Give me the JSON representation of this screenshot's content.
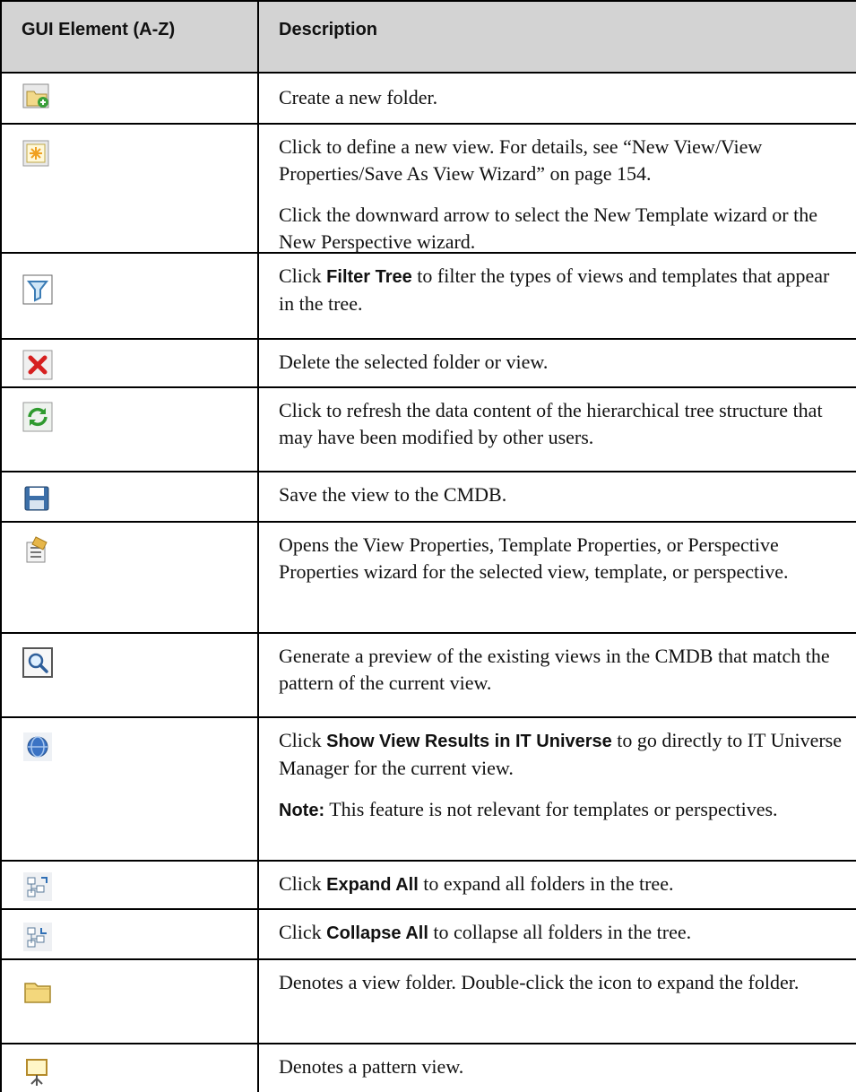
{
  "header": {
    "col1": "GUI Element (A-Z)",
    "col2": "Description"
  },
  "rows": [
    {
      "icon": "new-folder-icon",
      "paras": [
        {
          "text": "Create a new folder."
        }
      ]
    },
    {
      "icon": "new-view-icon",
      "paras": [
        {
          "text": "Click to define a new view. For details, see “New View/View Properties/Save As View Wizard” on page 154."
        },
        {
          "text": "Click the downward arrow to select the New Template wizard or the New Perspective wizard."
        }
      ]
    },
    {
      "icon": "filter-icon",
      "paras": [
        {
          "pre": "Click ",
          "bold": "Filter Tree",
          "post": " to filter the types of views and templates that appear in the tree."
        }
      ]
    },
    {
      "icon": "delete-icon",
      "paras": [
        {
          "text": "Delete the selected folder or view."
        }
      ]
    },
    {
      "icon": "refresh-icon",
      "paras": [
        {
          "text": "Click to refresh the data content of the hierarchical tree structure that may have been modified by other users."
        }
      ]
    },
    {
      "icon": "save-icon",
      "paras": [
        {
          "text": "Save the view to the CMDB."
        }
      ]
    },
    {
      "icon": "properties-icon",
      "paras": [
        {
          "text": "Opens the View Properties, Template Properties, or Perspective Properties wizard for the selected view, template, or perspective."
        }
      ]
    },
    {
      "icon": "preview-icon",
      "paras": [
        {
          "text": "Generate a preview of the existing views in the CMDB that match the pattern of the current view."
        }
      ]
    },
    {
      "icon": "globe-icon",
      "paras": [
        {
          "pre": "Click ",
          "bold": "Show View Results in IT Universe",
          "post": " to go directly to IT Universe Manager for the current view."
        },
        {
          "pre": "",
          "bold": "Note:",
          "post": " This feature is not relevant for templates or perspectives."
        }
      ]
    },
    {
      "icon": "expand-all-icon",
      "paras": [
        {
          "pre": "Click ",
          "bold": "Expand All",
          "post": " to expand all folders in the tree."
        }
      ]
    },
    {
      "icon": "collapse-all-icon",
      "paras": [
        {
          "pre": "Click ",
          "bold": "Collapse All",
          "post": " to collapse all folders in the tree."
        }
      ]
    },
    {
      "icon": "folder-icon",
      "paras": [
        {
          "text": "Denotes a view folder. Double-click the icon to expand the folder."
        }
      ]
    },
    {
      "icon": "pattern-view-icon",
      "paras": [
        {
          "text": "Denotes a pattern view."
        }
      ]
    }
  ]
}
